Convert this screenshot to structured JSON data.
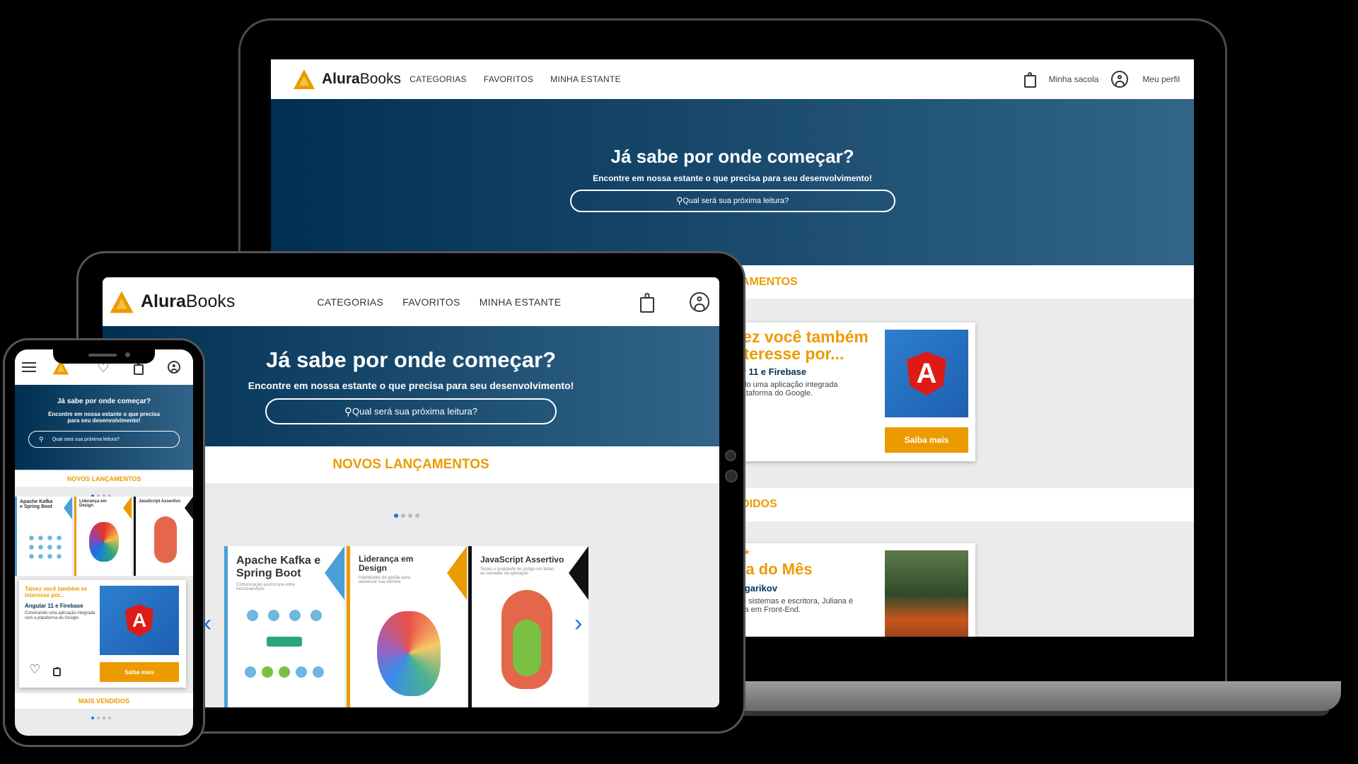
{
  "brand": {
    "name_bold": "Alura",
    "name_light": "Books"
  },
  "nav": {
    "categories": "CATEGORIAS",
    "favorites": "FAVORITOS",
    "shelf": "MINHA ESTANTE"
  },
  "header": {
    "bag_label": "Minha sacola",
    "profile_label": "Meu perfil"
  },
  "hero": {
    "title": "Já sabe por onde começar?",
    "subtitle": "Encontre em nossa estante o que precisa para seu desenvolvimento!",
    "search_placeholder": "Qual será sua próxima leitura?",
    "phone_subtitle_line1": "Encontre em nossa estante o que precisa",
    "phone_subtitle_line2": "para seu desenvolvimento!"
  },
  "sections": {
    "new_releases": "NOVOS LANÇAMENTOS",
    "best_sellers": "MAIS VENDIDOS",
    "laptop_new_fragment": "AMENTOS",
    "laptop_best_fragment": "DIDOS"
  },
  "recommend": {
    "title": "Talvez você também se interesse por...",
    "laptop_title_line1": "lvez você também",
    "laptop_title_line2": "interesse por...",
    "book": "Angular 11 e Firebase",
    "laptop_book": "ular 11 e Firebase",
    "description": "Construindo uma aplicação integrada com a plataforma do Google.",
    "laptop_desc_line1": "ruindo uma aplicação integrada",
    "laptop_desc_line2": "a plataforma do Google.",
    "button": "Saiba mais",
    "cover_letter": "A"
  },
  "author": {
    "stars": "★ ★ ★",
    "title": "tora do Mês",
    "name": "na Agarikov",
    "desc_line1": "sta de sistemas e escritora, Juliana é",
    "desc_line2": "cialista em Front-End."
  },
  "books": [
    {
      "title": "Apache Kafka e Spring Boot",
      "subtitle": "Comunicação assíncrona entre microsserviços",
      "accent": "#4a9fd8"
    },
    {
      "title": "Liderança em Design",
      "subtitle": "Habilidades de gestão para alavancar sua carreira",
      "accent": "#eb9b00"
    },
    {
      "title": "JavaScript Assertivo",
      "subtitle": "Testes e qualidade de código em todas as camadas da aplicação",
      "accent": "#111111"
    }
  ],
  "colors": {
    "accent": "#eb9b00",
    "hero_dark": "#002f52",
    "hero_light": "#326589",
    "dot_active": "#1875e8"
  },
  "icons": [
    "logo-icon",
    "bag-icon",
    "user-icon",
    "search-icon",
    "heart-icon",
    "menu-icon",
    "chevron-left-icon",
    "chevron-right-icon"
  ]
}
